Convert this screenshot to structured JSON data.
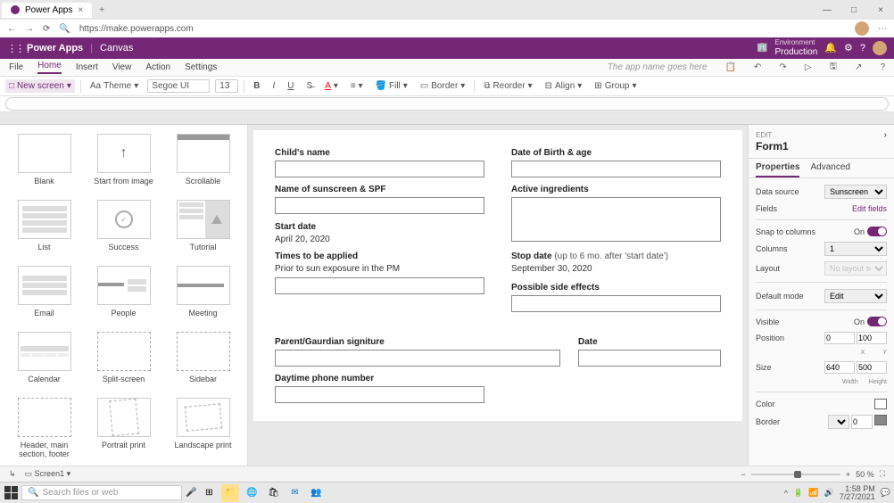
{
  "browser": {
    "tab_title": "Power Apps",
    "url": "https://make.powerapps.com"
  },
  "suite": {
    "app": "Power Apps",
    "context": "Canvas",
    "env_label": "Environment",
    "env_name": "Production"
  },
  "menu": {
    "items": [
      "File",
      "Home",
      "Insert",
      "View",
      "Action",
      "Settings"
    ],
    "active": "Home",
    "app_name_placeholder": "The app name goes here"
  },
  "ribbon": {
    "new_screen": "New screen",
    "theme": "Theme",
    "font": "Segoe UI",
    "font_size": "13",
    "fill": "Fill",
    "border": "Border",
    "reorder": "Reorder",
    "align": "Align",
    "group": "Group"
  },
  "gallery": [
    {
      "label": "Blank",
      "tpl": "blank"
    },
    {
      "label": "Start from image",
      "tpl": "arrow"
    },
    {
      "label": "Scrollable",
      "tpl": "scroll"
    },
    {
      "label": "List",
      "tpl": "list"
    },
    {
      "label": "Success",
      "tpl": "success"
    },
    {
      "label": "Tutorial",
      "tpl": "tutorial"
    },
    {
      "label": "Email",
      "tpl": "email"
    },
    {
      "label": "People",
      "tpl": "people"
    },
    {
      "label": "Meeting",
      "tpl": "meeting"
    },
    {
      "label": "Calendar",
      "tpl": "calendar"
    },
    {
      "label": "Split-screen",
      "tpl": "split"
    },
    {
      "label": "Sidebar",
      "tpl": "sidebar"
    },
    {
      "label": "Header, main section, footer",
      "tpl": "hmf"
    },
    {
      "label": "Portrait print",
      "tpl": "portrait"
    },
    {
      "label": "Landscape print",
      "tpl": "landscape"
    }
  ],
  "form": {
    "child_name": "Child's name",
    "dob": "Date of Birth & age",
    "sunscreen": "Name of sunscreen & SPF",
    "ingredients": "Active ingredients",
    "start_date": "Start date",
    "start_date_val": "April 20, 2020",
    "times": "Times to be applied",
    "times_val": "Prior to sun exposure in the PM",
    "stop_date": "Stop date",
    "stop_date_hint": "(up to 6 mo. after 'start date')",
    "stop_date_val": "September 30, 2020",
    "side_effects": "Possible side effects",
    "signature": "Parent/Gaurdian signiture",
    "date": "Date",
    "phone": "Daytime phone number"
  },
  "props": {
    "edit": "EDIT",
    "name": "Form1",
    "tabs": [
      "Properties",
      "Advanced"
    ],
    "data_source": "Data source",
    "data_source_val": "Sunscreen",
    "fields": "Fields",
    "edit_fields": "Edit fields",
    "snap": "Snap to columns",
    "on": "On",
    "columns": "Columns",
    "columns_val": "1",
    "layout": "Layout",
    "layout_val": "No layout selected",
    "default_mode": "Default mode",
    "default_mode_val": "Edit",
    "visible": "Visible",
    "position": "Position",
    "pos_x": "0",
    "pos_y": "100",
    "x_lbl": "X",
    "y_lbl": "Y",
    "size": "Size",
    "width": "640",
    "height": "500",
    "w_lbl": "Width",
    "h_lbl": "Height",
    "color": "Color",
    "border": "Border",
    "border_val": "0"
  },
  "status": {
    "screen": "Screen1",
    "zoom": "50 %"
  },
  "taskbar": {
    "search": "Search files or web",
    "time": "1:58 PM",
    "date": "7/27/2021"
  }
}
